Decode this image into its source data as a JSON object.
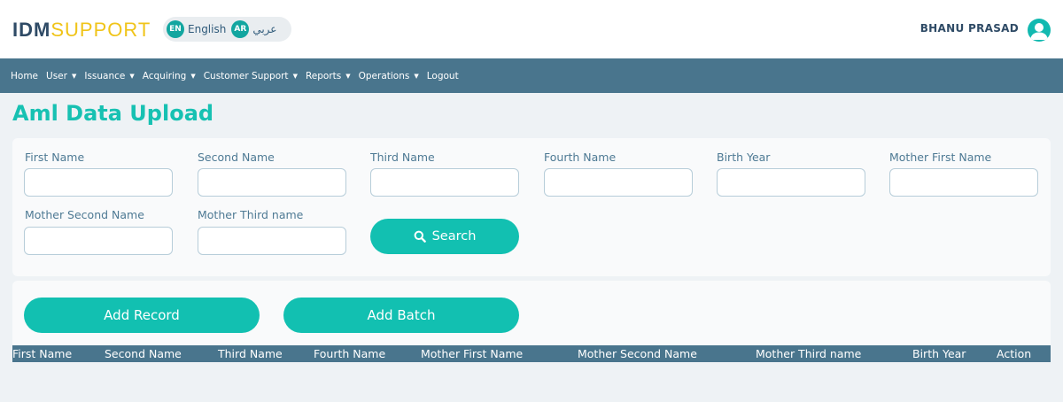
{
  "header": {
    "logo_primary": "IDM",
    "logo_secondary": "SUPPORT",
    "language": {
      "en_badge": "EN",
      "en_label": "English",
      "ar_badge": "AR",
      "ar_label": "عربي"
    },
    "user_name": "BHANU PRASAD"
  },
  "nav": {
    "items": [
      {
        "label": "Home",
        "dropdown": false
      },
      {
        "label": "User",
        "dropdown": true
      },
      {
        "label": "Issuance",
        "dropdown": true
      },
      {
        "label": "Acquiring",
        "dropdown": true
      },
      {
        "label": "Customer Support",
        "dropdown": true
      },
      {
        "label": "Reports",
        "dropdown": true
      },
      {
        "label": "Operations",
        "dropdown": true
      },
      {
        "label": "Logout",
        "dropdown": false
      }
    ]
  },
  "page": {
    "title": "Aml Data Upload"
  },
  "search_form": {
    "fields": [
      {
        "label": "First Name",
        "value": ""
      },
      {
        "label": "Second Name",
        "value": ""
      },
      {
        "label": "Third Name",
        "value": ""
      },
      {
        "label": "Fourth Name",
        "value": ""
      },
      {
        "label": "Birth Year",
        "value": ""
      },
      {
        "label": "Mother First Name",
        "value": ""
      },
      {
        "label": "Mother Second Name",
        "value": ""
      },
      {
        "label": "Mother Third name",
        "value": ""
      }
    ],
    "search_button": "Search"
  },
  "actions": {
    "add_record": "Add Record",
    "add_batch": "Add Batch"
  },
  "table": {
    "columns": [
      "First Name",
      "Second Name",
      "Third Name",
      "Fourth Name",
      "Mother First Name",
      "Mother Second Name",
      "Mother Third name",
      "Birth Year",
      "Action"
    ],
    "rows": []
  },
  "colors": {
    "accent": "#12c0b1",
    "nav_bar": "#49758d",
    "logo_primary": "#2f4b66",
    "logo_secondary": "#f0c419"
  }
}
